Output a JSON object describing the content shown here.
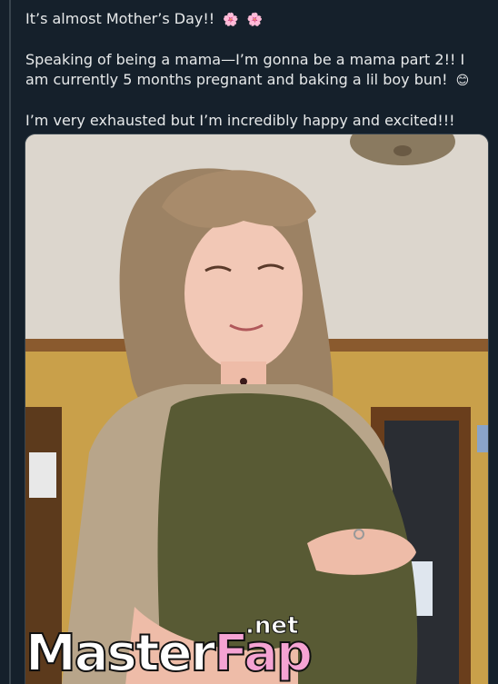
{
  "post": {
    "line1": "It’s almost Mother’s Day!!",
    "line1_emoji_a": "🌸",
    "line1_emoji_b": "🌸",
    "line2": "Speaking of being a mama—I’m gonna be a mama part 2!! I am currently 5 months pregnant and baking a lil boy bun!",
    "line2_emoji": "😊",
    "line3": "I’m very exhausted but I’m incredibly happy and excited!!!"
  },
  "media": {
    "alt_icon": "photo-icon"
  },
  "watermark": {
    "brand_main": "Master",
    "brand_accent": "Fap",
    "brand_tld": ".net"
  },
  "colors": {
    "background": "#15202b",
    "text": "#e7e9ea",
    "border": "#38444d",
    "watermark_accent": "#f5a3d3"
  }
}
